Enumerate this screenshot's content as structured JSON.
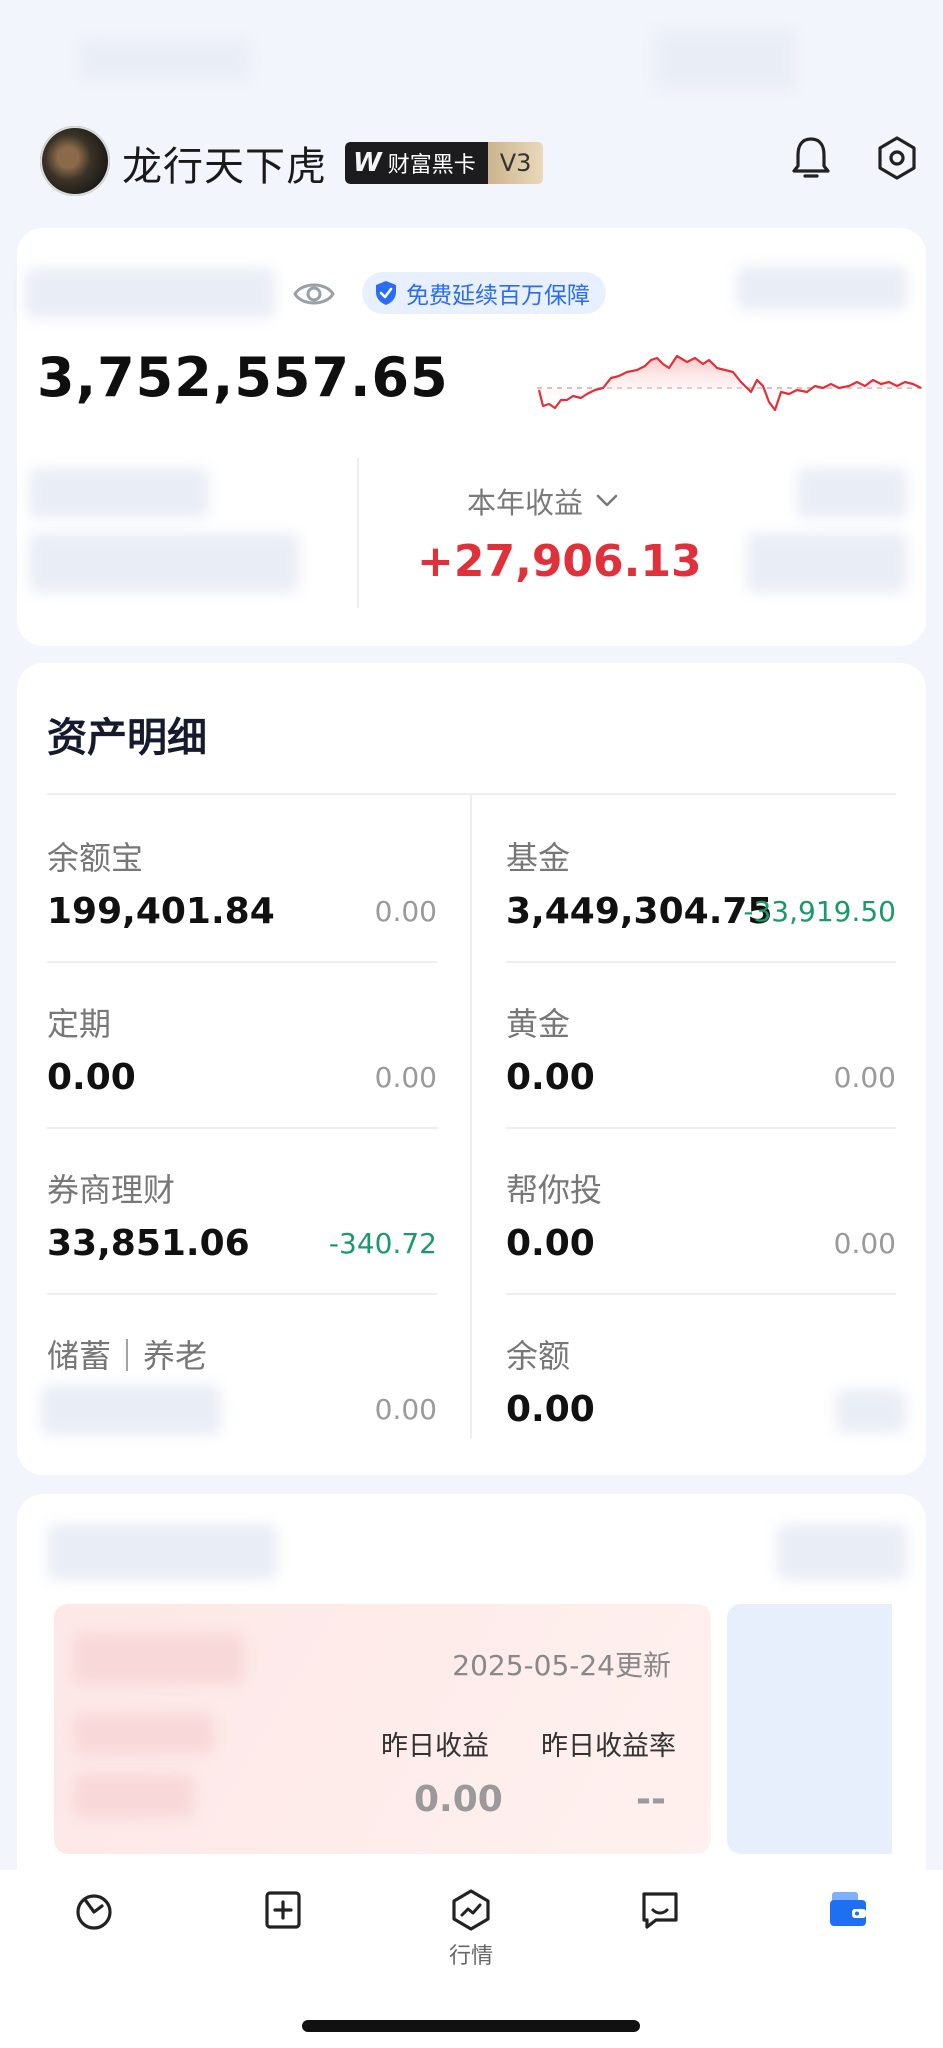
{
  "header": {
    "username": "龙行天下虎",
    "badge_label": "财富黑卡",
    "badge_level": "V3"
  },
  "summary": {
    "protect_label": "免费延续百万保障",
    "total_assets": "3,752,557.65",
    "year_income_label": "本年收益",
    "year_income_value": "+27,906.13"
  },
  "assets": {
    "title": "资产明细",
    "items": [
      {
        "label": "余额宝",
        "value": "199,401.84",
        "change": "0.00"
      },
      {
        "label": "基金",
        "value": "3,449,304.75",
        "change": "-33,919.50"
      },
      {
        "label": "定期",
        "value": "0.00",
        "change": "0.00"
      },
      {
        "label": "黄金",
        "value": "0.00",
        "change": "0.00"
      },
      {
        "label": "券商理财",
        "value": "33,851.06",
        "change": "-340.72"
      },
      {
        "label": "帮你投",
        "value": "0.00",
        "change": "0.00"
      },
      {
        "label": "储蓄｜养老",
        "value": "",
        "change": "0.00"
      },
      {
        "label": "余额",
        "value": "0.00",
        "change": ""
      }
    ]
  },
  "earnings": {
    "updated": "2025-05-24更新",
    "yesterday_income_label": "昨日收益",
    "yesterday_rate_label": "昨日收益率",
    "yesterday_income_value": "0.00",
    "yesterday_rate_value": "--"
  },
  "tabbar": {
    "market_label": "行情"
  },
  "colors": {
    "positive": "#e0303a",
    "negative": "#1a9a6a",
    "accent": "#2a6df4"
  }
}
